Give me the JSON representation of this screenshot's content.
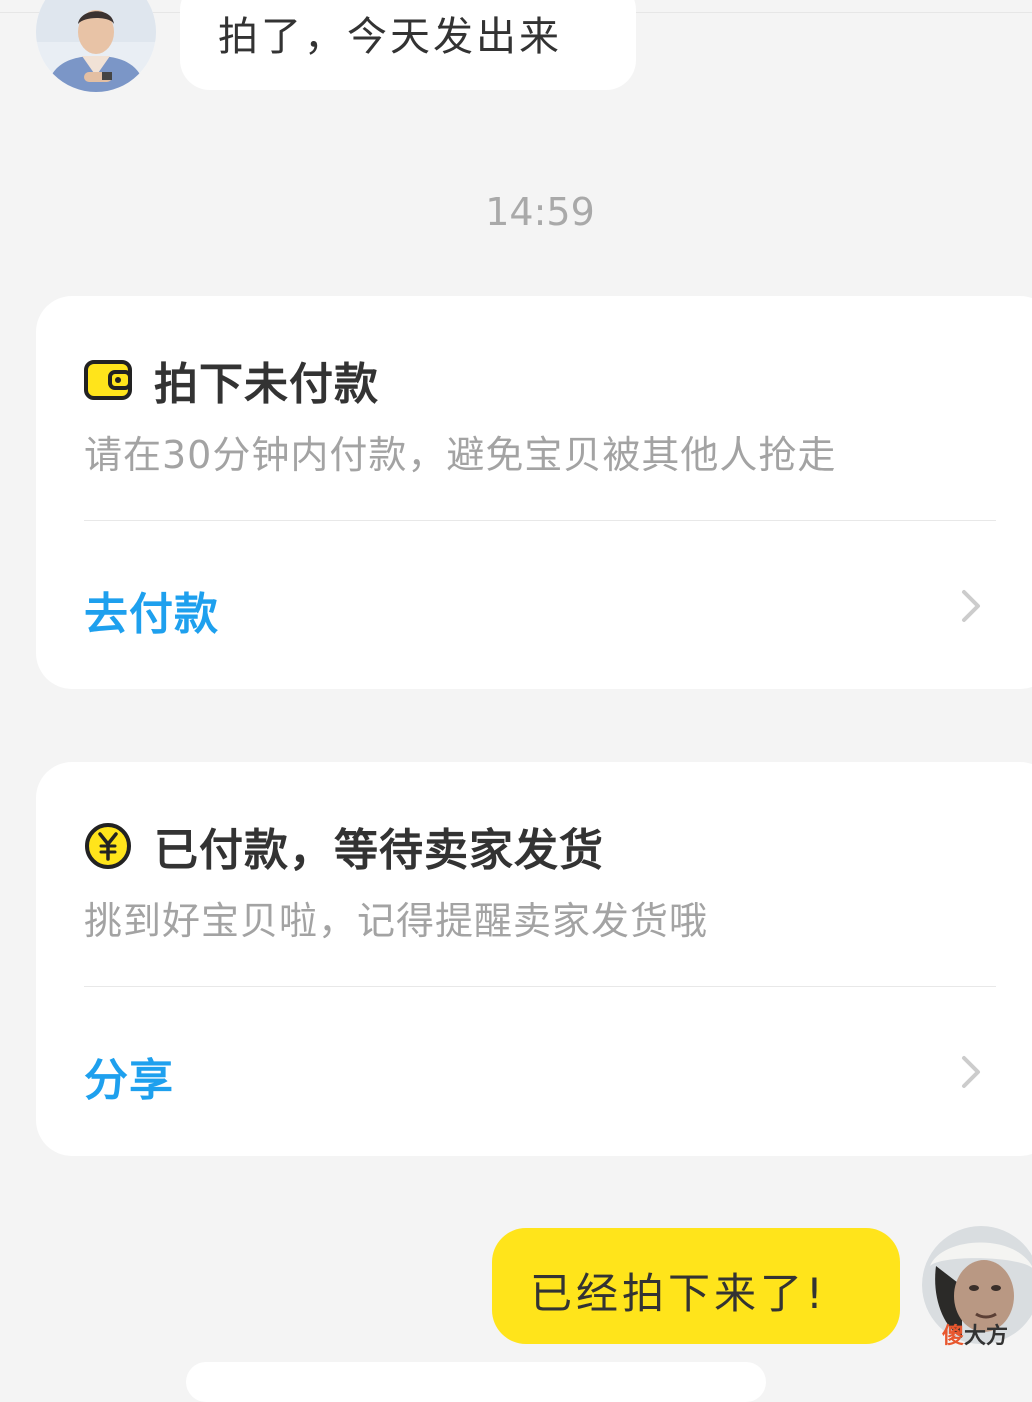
{
  "chat": {
    "incoming_message": "拍了，今天发出来",
    "timestamp": "14:59",
    "outgoing_message": "已经拍下来了!"
  },
  "cards": [
    {
      "icon": "wallet-icon",
      "title": "拍下未付款",
      "subtitle": "请在30分钟内付款，避免宝贝被其他人抢走",
      "action": "去付款"
    },
    {
      "icon": "yuan-coin-icon",
      "title": "已付款，等待卖家发货",
      "subtitle": "挑到好宝贝啦，记得提醒卖家发货哦",
      "action": "分享"
    }
  ],
  "watermark": {
    "accent": "傻",
    "rest": "大方"
  },
  "colors": {
    "background": "#f4f4f4",
    "card": "#ffffff",
    "action_blue": "#1ea0ee",
    "accent_yellow": "#ffe41b"
  }
}
